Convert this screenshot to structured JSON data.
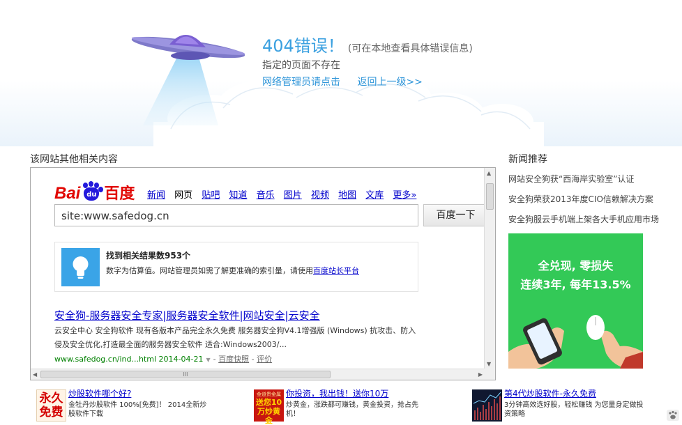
{
  "error": {
    "code_title": "404错误！",
    "hint": "(可在本地查看具体错误信息)",
    "subtitle": "指定的页面不存在",
    "admin_link": "网络管理员请点击",
    "back_link": "返回上一级>>"
  },
  "related": {
    "heading": "该网站其他相关内容"
  },
  "baidu": {
    "logo_left": "Bai",
    "logo_paw": "du",
    "logo_right": "百度",
    "nav": [
      "新闻",
      "网页",
      "贴吧",
      "知道",
      "音乐",
      "图片",
      "视频",
      "地图",
      "文库",
      "更多»"
    ],
    "search_value": "site:www.safedog.cn",
    "search_button": "百度一下",
    "result_count": "找到相关结果数953个",
    "count_note": "数字为估算值。网站管理员如需了解更准确的索引量，请使用",
    "count_link": "百度站长平台",
    "result": {
      "title": "安全狗-服务器安全专家|服务器安全软件|网站安全|云安全",
      "desc": "云安全中心 安全狗软件 现有各版本产品完全永久免费 服务器安全狗V4.1增强版 (Windows) 抗攻击、防入侵及安全优化,打造最全面的服务器安全软件 适合:Windows2003/...",
      "url": "www.safedog.cn/ind...html 2014-04-21",
      "cache": "百度快照",
      "sep": "-",
      "review": "评价"
    },
    "scroll_mid": "III"
  },
  "news": {
    "heading": "新闻推荐",
    "items": [
      "网站安全狗获“西海岸实验室”认证",
      "安全狗荣获2013年度CIO信赖解决方案",
      "安全狗服云手机端上架各大手机应用市场"
    ],
    "ad": {
      "line1": "全兑现, 零损失",
      "line2": "连续3年, 每年13.5%"
    }
  },
  "bottom_ads": [
    {
      "thumb_text": "永久免费",
      "title": "炒股软件哪个好?",
      "desc": "金牡丹炒股软件 100%[免费]！ 2014全新炒股软件下载"
    },
    {
      "thumb_text": "送您10万炒黄金",
      "thumb_top": "金道贵金属",
      "title": "你投资，我出钱！送你10万",
      "desc": "炒黄金，涨跌都可赚钱，黄金投资，抢占先机！"
    },
    {
      "title": "第4代炒股软件-永久免费",
      "desc": "3分钟高效选好股，轻松赚钱 为您量身定做投资策略"
    }
  ],
  "colors": {
    "accent": "#3aa0e0",
    "baidu_red": "#e10602",
    "baidu_blue": "#2319dc",
    "ad_green": "#33c957"
  }
}
